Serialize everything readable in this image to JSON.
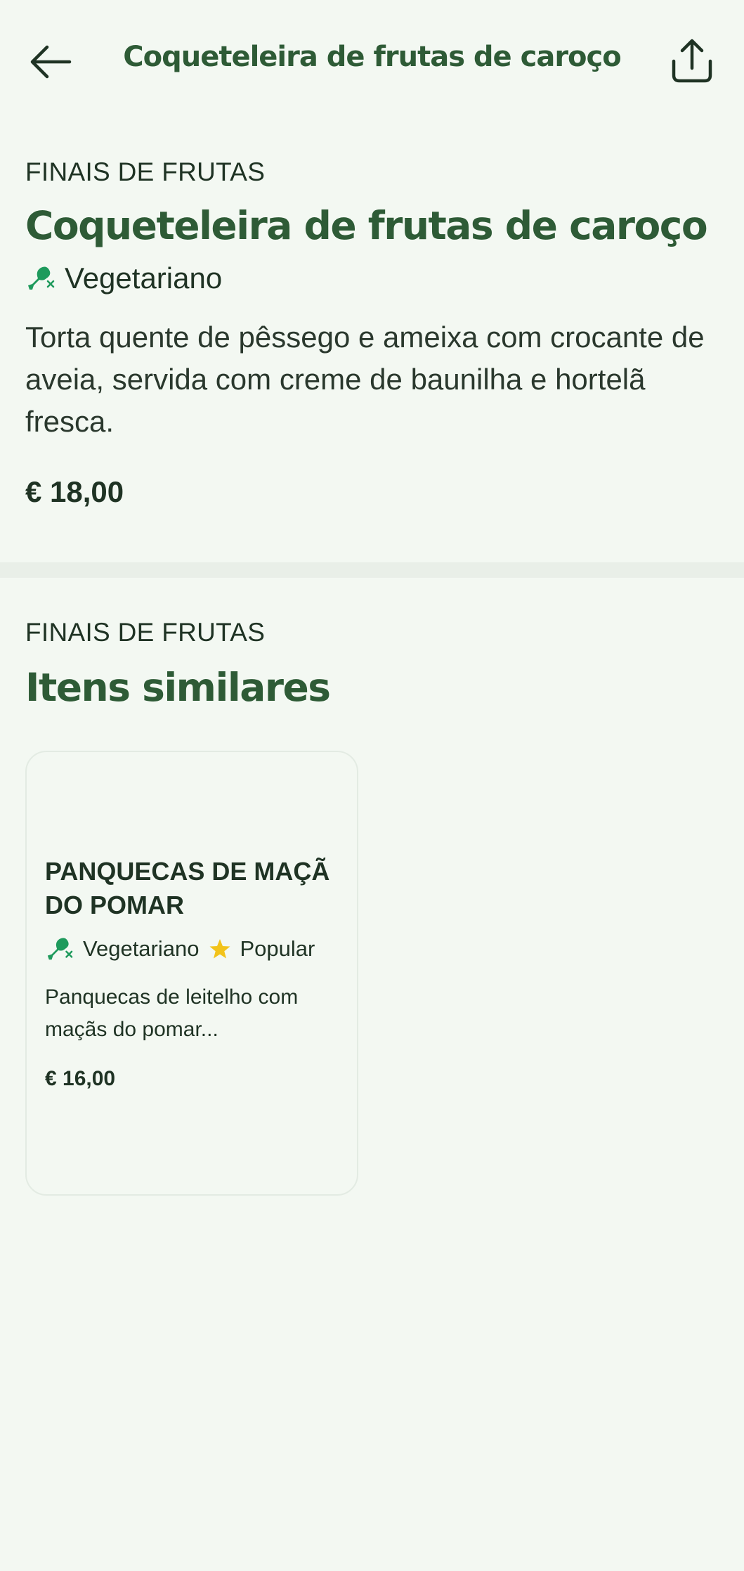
{
  "header": {
    "title": "Coqueteleira de frutas de caroço",
    "back_icon": "arrow-left-icon",
    "share_icon": "share-icon"
  },
  "item": {
    "category": "FINAIS DE FRUTAS",
    "title": "Coqueteleira de frutas de caroço",
    "diet_label": "Vegetariano",
    "diet_icon": "drumstick-crossed-icon",
    "description": "Torta quente de pêssego e ameixa com crocante de aveia, servida com creme de baunilha e hortelã fresca.",
    "price": "€ 18,00"
  },
  "similar": {
    "category": "FINAIS DE FRUTAS",
    "title": "Itens similares",
    "items": [
      {
        "title": "PANQUECAS DE MAÇÃ DO POMAR",
        "diet_label": "Vegetariano",
        "popular_label": "Popular",
        "description": "Panquecas de leitelho com maçãs do pomar...",
        "price": "€ 16,00"
      }
    ]
  },
  "colors": {
    "background": "#f3f8f2",
    "brand_green": "#2e5b36",
    "veg_icon_green": "#1e9a5c",
    "star_yellow": "#f2c31b",
    "divider": "#e9efe8"
  }
}
